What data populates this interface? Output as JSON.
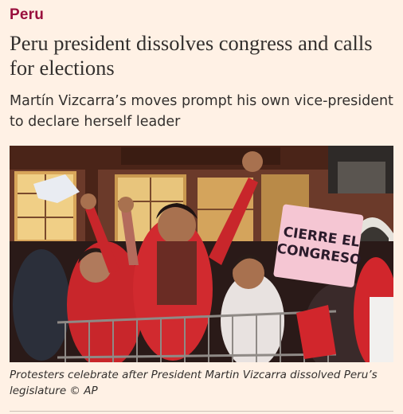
{
  "article": {
    "section": "Peru",
    "headline": "Peru president dissolves congress and calls for elections",
    "standfirst": "Martín Vizcarra’s moves prompt his own vice-president to declare herself leader",
    "image": {
      "sign_text": "CIERRE EL CONGRESO"
    },
    "caption": "Protesters celebrate after President Martin Vizcarra dissolved Peru’s legislature © AP"
  },
  "colors": {
    "background": "#fff1e5",
    "section_tag": "#990f3d",
    "text": "#33302e"
  }
}
